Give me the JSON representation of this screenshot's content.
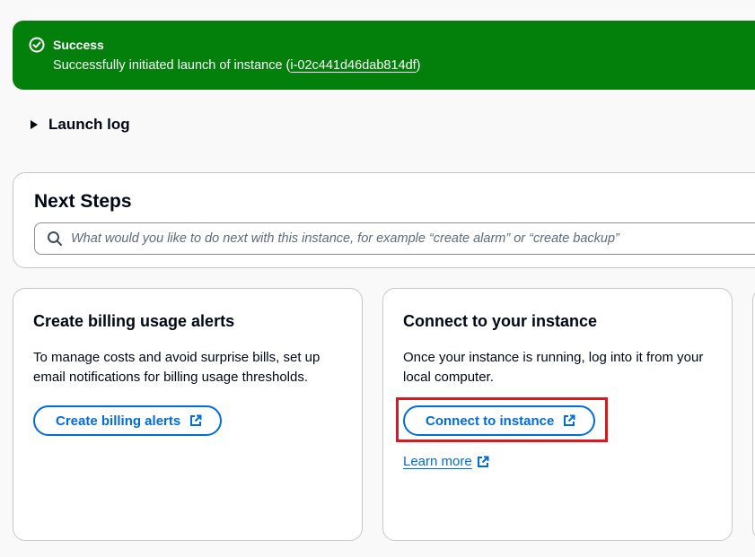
{
  "flash": {
    "type": "success",
    "icon": "check-circle-icon",
    "color": "#037f0c",
    "title": "Success",
    "message_prefix": "Successfully initiated launch of instance (",
    "instance_id": "i-02c441d46dab814df",
    "message_suffix": ")"
  },
  "launch_log": {
    "label": "Launch log",
    "expanded": false
  },
  "next_steps": {
    "title": "Next Steps",
    "search_placeholder": "What would you like to do next with this instance, for example “create alarm” or “create backup”",
    "search_value": ""
  },
  "cards": [
    {
      "title": "Create billing usage alerts",
      "description": "To manage costs and avoid surprise bills, set up email notifications for billing usage thresholds.",
      "button_label": "Create billing alerts",
      "button_icon": "external-link-icon"
    },
    {
      "title": "Connect to your instance",
      "description": "Once your instance is running, log into it from your local computer.",
      "button_label": "Connect to instance",
      "button_icon": "external-link-icon",
      "button_highlighted": true,
      "link_label": "Learn more",
      "link_icon": "external-link-icon"
    }
  ],
  "colors": {
    "primary_link": "#006ce0",
    "highlight_box": "#d71920",
    "success": "#037f0c"
  }
}
